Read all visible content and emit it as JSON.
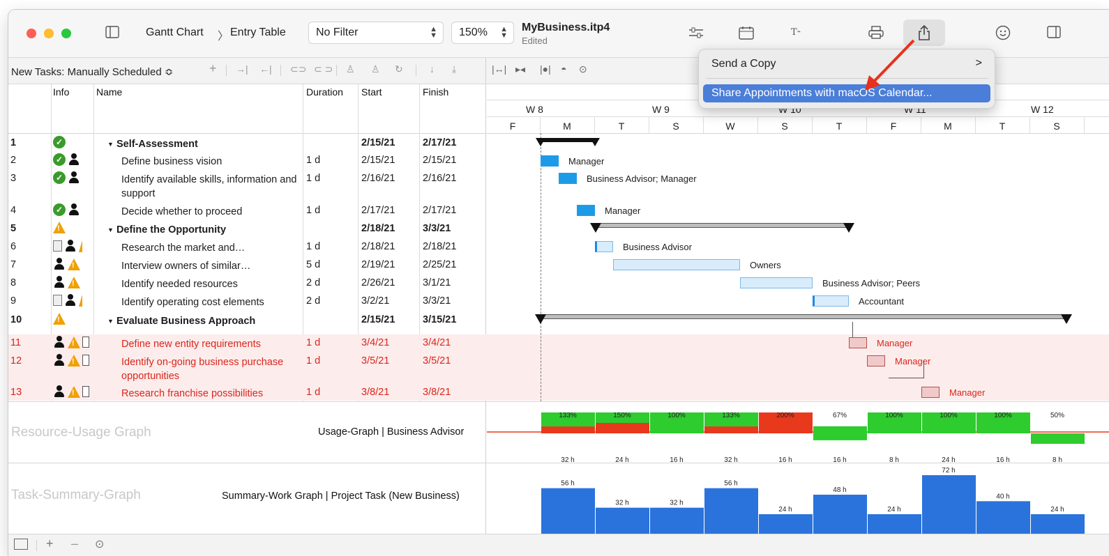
{
  "toolbar": {
    "breadcrumb_view": "Gantt Chart",
    "breadcrumb_sep": "〉",
    "breadcrumb_table": "Entry Table",
    "filter_value": "No Filter",
    "zoom_value": "150%",
    "doc_title": "MyBusiness.itp4",
    "doc_status": "Edited"
  },
  "subbar": {
    "new_tasks_label": "New Tasks: Manually Scheduled ≎"
  },
  "table": {
    "headers": {
      "info": "Info",
      "name": "Name",
      "duration": "Duration",
      "start": "Start",
      "finish": "Finish"
    },
    "rows": [
      {
        "num": "1",
        "name": "Self-Assessment",
        "duration": "",
        "start": "2/15/21",
        "finish": "2/17/21"
      },
      {
        "num": "2",
        "name": "Define business vision",
        "duration": "1 d",
        "start": "2/15/21",
        "finish": "2/15/21"
      },
      {
        "num": "3",
        "name": "Identify available skills, information and support",
        "duration": "1 d",
        "start": "2/16/21",
        "finish": "2/16/21"
      },
      {
        "num": "4",
        "name": "Decide whether to proceed",
        "duration": "1 d",
        "start": "2/17/21",
        "finish": "2/17/21"
      },
      {
        "num": "5",
        "name": "Define the Opportunity",
        "duration": "",
        "start": "2/18/21",
        "finish": "3/3/21"
      },
      {
        "num": "6",
        "name": "Research the market and…",
        "duration": "1 d",
        "start": "2/18/21",
        "finish": "2/18/21"
      },
      {
        "num": "7",
        "name": "Interview owners of similar…",
        "duration": "5 d",
        "start": "2/19/21",
        "finish": "2/25/21"
      },
      {
        "num": "8",
        "name": "Identify needed resources",
        "duration": "2 d",
        "start": "2/26/21",
        "finish": "3/1/21"
      },
      {
        "num": "9",
        "name": "Identify operating cost elements",
        "duration": "2 d",
        "start": "3/2/21",
        "finish": "3/3/21"
      },
      {
        "num": "10",
        "name": "Evaluate Business Approach",
        "duration": "",
        "start": "2/15/21",
        "finish": "3/15/21"
      },
      {
        "num": "11",
        "name": "Define new entity requirements",
        "duration": "1 d",
        "start": "3/4/21",
        "finish": "3/4/21"
      },
      {
        "num": "12",
        "name": "Identify on-going business purchase opportunities",
        "duration": "1 d",
        "start": "3/5/21",
        "finish": "3/5/21"
      },
      {
        "num": "13",
        "name": "Research franchise possibilities",
        "duration": "1 d",
        "start": "3/8/21",
        "finish": "3/8/21"
      }
    ]
  },
  "gantt": {
    "weeks": [
      "W 8",
      "W 9",
      "W 10",
      "W 11",
      "W 12"
    ],
    "days": [
      "F",
      "M",
      "T",
      "S",
      "W",
      "S",
      "T",
      "F",
      "M",
      "T",
      "S"
    ],
    "labels": {
      "r2": "Manager",
      "r3": "Business Advisor; Manager",
      "r4": "Manager",
      "r6": "Business Advisor",
      "r7": "Owners",
      "r8": "Business Advisor; Peers",
      "r9": "Accountant",
      "r11": "Manager",
      "r12": "Manager",
      "r13": "Manager"
    }
  },
  "usage_graph": {
    "side_label": "Resource-Usage Graph",
    "title": "Usage-Graph | Business Advisor",
    "percents": [
      "133%",
      "150%",
      "100%",
      "133%",
      "200%",
      "67%",
      "100%",
      "100%",
      "100%",
      "50%"
    ],
    "hours": [
      "32 h",
      "24 h",
      "16 h",
      "32 h",
      "16 h",
      "16 h",
      "8 h",
      "24 h",
      "16 h",
      "8 h"
    ],
    "over_percent_values": [
      133,
      150,
      100,
      133,
      200,
      67,
      100,
      100,
      100,
      50
    ]
  },
  "summary_graph": {
    "side_label": "Task-Summary-Graph",
    "title": "Summary-Work Graph | Project Task (New Business)",
    "hours": [
      "56 h",
      "32 h",
      "32 h",
      "56 h",
      "24 h",
      "48 h",
      "24 h",
      "72 h",
      "40 h",
      "24 h"
    ],
    "hour_values": [
      56,
      32,
      32,
      56,
      24,
      48,
      24,
      72,
      40,
      24
    ]
  },
  "popup": {
    "send_copy": "Send a Copy",
    "chevron": ">",
    "share_calendar": "Share Appointments with macOS Calendar..."
  },
  "colors": {
    "accent_blue": "#1e88e5",
    "critical_red": "#d9261c",
    "usage_green": "#2ecc2e",
    "usage_red": "#e8391d",
    "summary_blue": "#2a73dc",
    "menu_highlight": "#4a7ed8"
  }
}
